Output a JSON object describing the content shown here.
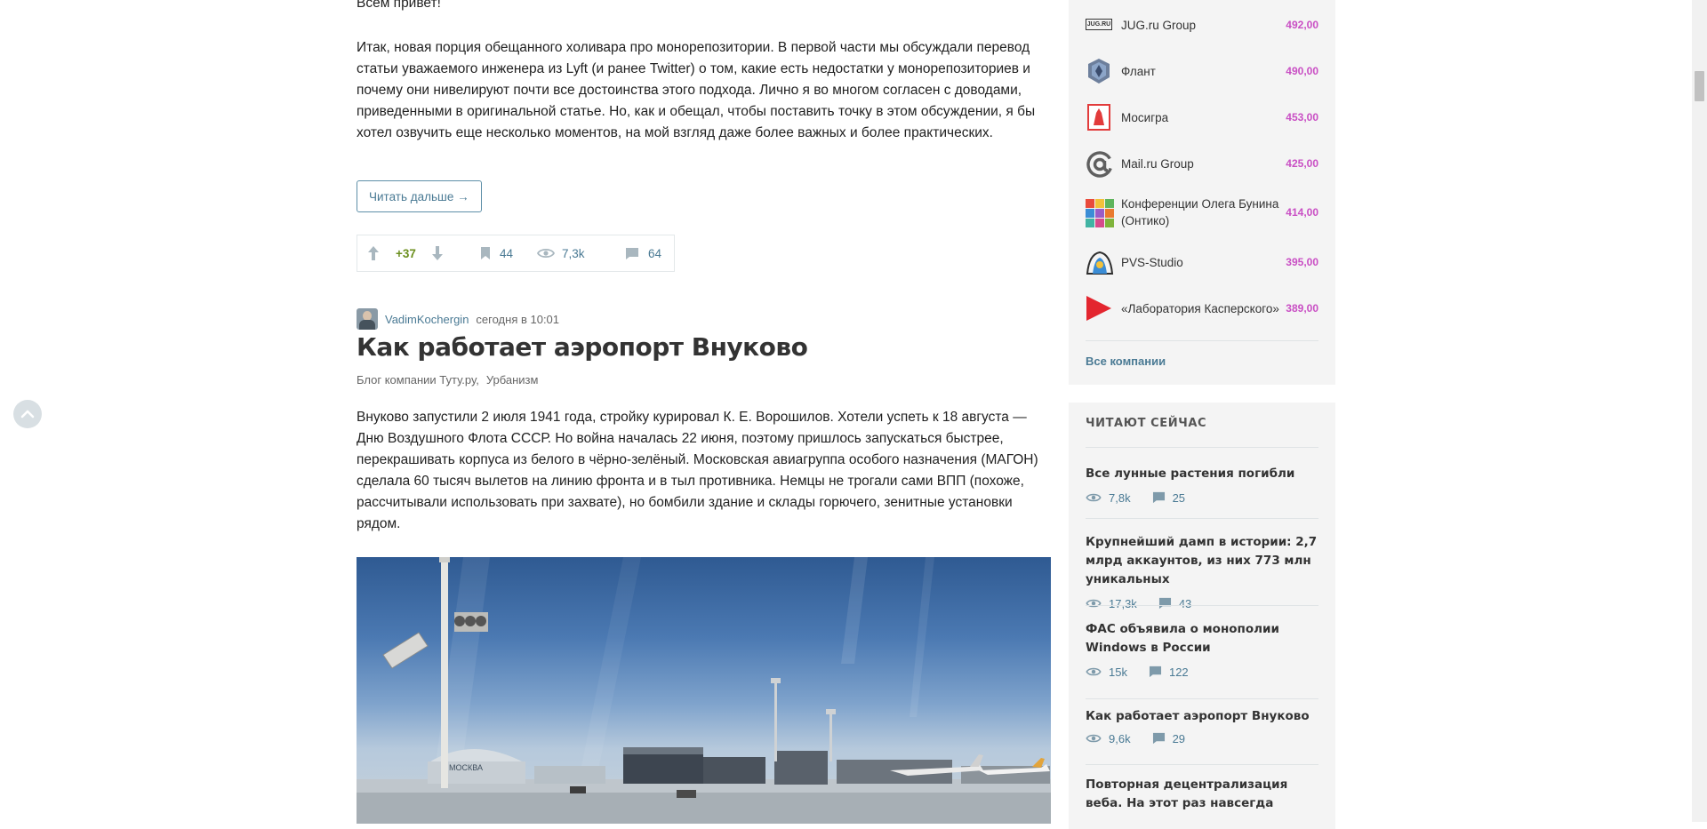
{
  "post_prev": {
    "greeting": "Всем привет!",
    "excerpt": "Итак, новая порция обещанного холивара про монорепозитории. В первой части мы обсуждали перевод статьи уважаемого инженера из Lyft (и ранее Twitter) о том, какие есть недостатки у монорепозиториев и почему они нивелируют почти все достоинства этого подхода. Лично я во многом согласен с доводами, приведенными в оригинальной статье. Но, как и обещал, чтобы поставить точку в этом обсуждении, я бы хотел озвучить еще несколько моментов, на мой взгляд даже более важных и более практических.",
    "read_more_label": "Читать дальше →",
    "stats": {
      "score": "+37",
      "bookmarks": "44",
      "views": "7,3k",
      "comments": "64"
    }
  },
  "post": {
    "author": "VadimKochergin",
    "time": "сегодня в 10:01",
    "title": "Как работает аэропорт Внуково",
    "hubs": [
      "Блог компании Туту.ру,",
      "Урбанизм"
    ],
    "lead": "Внуково запустили 2 июля 1941 года, стройку курировал К. Е. Ворошилов. Хотели успеть к 18 августа — Дню Воздушного Флота СССР. Но война началась 22 июня, поэтому пришлось запускаться быстрее, перекрашивать корпуса из белого в чёрно-зелёный. Московская авиагруппа особого назначения (МАГОН) сделала 60 тысяч вылетов на линию фронта и в тыл противника. Немцы не трогали сами ВПП (похоже, рассчитывали использовать при захвате), но бомбили здание и склады горючего, зенитные установки рядом.",
    "image_terminal_text": "МОСКВА"
  },
  "companies": {
    "items": [
      {
        "name": "JUG.ru Group",
        "rating": "492,00",
        "logo_text": "JUG.RU"
      },
      {
        "name": "Флант",
        "rating": "490,00"
      },
      {
        "name": "Мосигра",
        "rating": "453,00"
      },
      {
        "name": "Mail.ru Group",
        "rating": "425,00"
      },
      {
        "name": "Конференции Олега Бунина (Онтико)",
        "rating": "414,00"
      },
      {
        "name": "PVS-Studio",
        "rating": "395,00"
      },
      {
        "name": "«Лаборатория Касперского»",
        "rating": "389,00"
      }
    ],
    "all_label": "Все компании"
  },
  "reading_now": {
    "heading": "ЧИТАЮТ СЕЙЧАС",
    "items": [
      {
        "title": "Все лунные растения погибли",
        "views": "7,8k",
        "comments": "25"
      },
      {
        "title": "Крупнейший дамп в истории: 2,7 млрд аккаунтов, из них 773 млн уникальных",
        "views": "17,3k",
        "comments": "43"
      },
      {
        "title": "ФАС объявила о монополии Windows в России",
        "views": "15k",
        "comments": "122"
      },
      {
        "title": "Как работает аэропорт Внуково",
        "views": "9,6k",
        "comments": "29"
      },
      {
        "title": "Повторная децентрализация веба. На этот раз навсегда"
      }
    ]
  },
  "colors": {
    "link": "#4a7a94",
    "rating": "#c94fc4",
    "score_positive": "#6b8f1e",
    "sidebar_bg": "#f4f4f4"
  }
}
